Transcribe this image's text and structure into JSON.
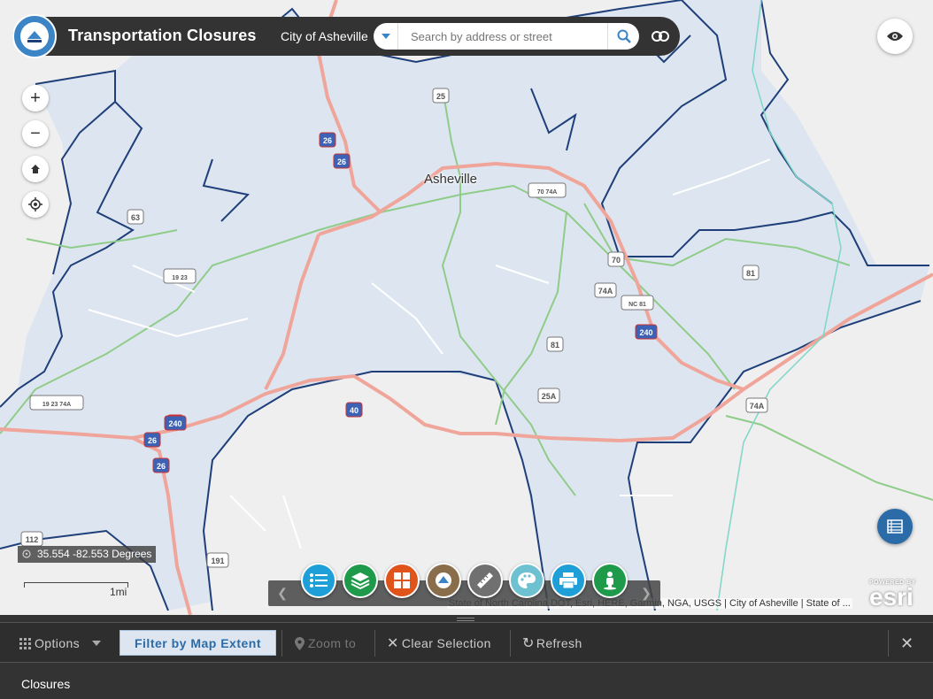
{
  "header": {
    "title": "Transportation Closures",
    "city_label": "City of Asheville",
    "search_placeholder": "Search by address or street"
  },
  "map": {
    "city_label": "Asheville",
    "coordinates": "35.554 -82.553 Degrees",
    "scale_label": "1mi",
    "attribution": "State of North Carolina DOT, Esri, HERE, Garmin, NGA, USGS | City of Asheville | State of ...",
    "esri_small": "POWERED BY",
    "esri_logo": "esri",
    "route_shields": [
      "26",
      "26",
      "26",
      "26",
      "26",
      "40",
      "240",
      "240",
      "25",
      "63",
      "19 23",
      "19 23 74A",
      "70 74A",
      "70",
      "74A",
      "NC 81",
      "81",
      "81",
      "25A",
      "74A",
      "112",
      "191"
    ]
  },
  "toolbar": {
    "tools": [
      {
        "name": "legend",
        "color": "#1e9fd8",
        "icon": "list-icon"
      },
      {
        "name": "layers",
        "color": "#1f9a4a",
        "icon": "layers-icon"
      },
      {
        "name": "basemap",
        "color": "#e0541c",
        "icon": "grid-icon"
      },
      {
        "name": "about",
        "color": "#8a6d4a",
        "icon": "city-logo-icon"
      },
      {
        "name": "measure",
        "color": "#707070",
        "icon": "ruler-icon"
      },
      {
        "name": "draw",
        "color": "#6ec1d0",
        "icon": "palette-icon"
      },
      {
        "name": "print",
        "color": "#1e9fd8",
        "icon": "printer-icon"
      },
      {
        "name": "street-view",
        "color": "#1f9a4a",
        "icon": "pegman-icon"
      }
    ]
  },
  "panel": {
    "options_label": "Options",
    "filter_label": "Filter by Map Extent",
    "zoom_label": "Zoom to",
    "clear_label": "Clear Selection",
    "refresh_label": "Refresh",
    "tab_label": "Closures"
  },
  "colors": {
    "header_bg": "#333333",
    "accent": "#3b84c6",
    "boundary": "#1f3f7a",
    "city_fill": "#dde6f0",
    "interstate": "#f0a59a"
  }
}
